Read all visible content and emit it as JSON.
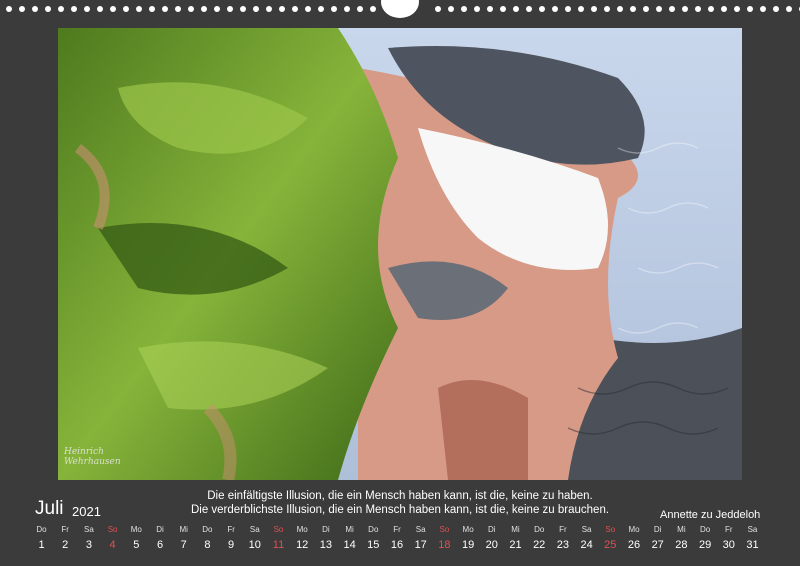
{
  "calendar": {
    "month": "Juli",
    "year": "2021",
    "quote_line1": "Die einfältigste Illusion, die ein Mensch haben kann, ist die, keine zu haben.",
    "quote_line2": "Die verderblichste Illusion, die ein Mensch haben kann, ist die, keine zu brauchen.",
    "author": "Annette zu Jeddeloh",
    "sunday_color": "#e25050",
    "days": [
      {
        "wd": "Do",
        "n": "1"
      },
      {
        "wd": "Fr",
        "n": "2"
      },
      {
        "wd": "Sa",
        "n": "3"
      },
      {
        "wd": "So",
        "n": "4",
        "sun": true
      },
      {
        "wd": "Mo",
        "n": "5"
      },
      {
        "wd": "Di",
        "n": "6"
      },
      {
        "wd": "Mi",
        "n": "7"
      },
      {
        "wd": "Do",
        "n": "8"
      },
      {
        "wd": "Fr",
        "n": "9"
      },
      {
        "wd": "Sa",
        "n": "10"
      },
      {
        "wd": "So",
        "n": "11",
        "sun": true
      },
      {
        "wd": "Mo",
        "n": "12"
      },
      {
        "wd": "Di",
        "n": "13"
      },
      {
        "wd": "Mi",
        "n": "14"
      },
      {
        "wd": "Do",
        "n": "15"
      },
      {
        "wd": "Fr",
        "n": "16"
      },
      {
        "wd": "Sa",
        "n": "17"
      },
      {
        "wd": "So",
        "n": "18",
        "sun": true
      },
      {
        "wd": "Mo",
        "n": "19"
      },
      {
        "wd": "Di",
        "n": "20"
      },
      {
        "wd": "Mi",
        "n": "21"
      },
      {
        "wd": "Do",
        "n": "22"
      },
      {
        "wd": "Fr",
        "n": "23"
      },
      {
        "wd": "Sa",
        "n": "24"
      },
      {
        "wd": "So",
        "n": "25",
        "sun": true
      },
      {
        "wd": "Mo",
        "n": "26"
      },
      {
        "wd": "Di",
        "n": "27"
      },
      {
        "wd": "Mi",
        "n": "28"
      },
      {
        "wd": "Do",
        "n": "29"
      },
      {
        "wd": "Fr",
        "n": "30"
      },
      {
        "wd": "Sa",
        "n": "31"
      }
    ]
  },
  "photo": {
    "signature_line1": "Heinrich",
    "signature_line2": "Wehrhausen"
  }
}
